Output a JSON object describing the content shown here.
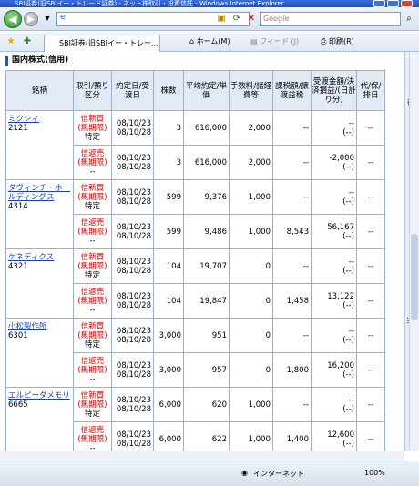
{
  "window": {
    "title": "SBI証券(旧SBIイー・トレード証券) - ネット株取引・投資信託 - Windows Internet Explorer"
  },
  "address": {
    "url": "e",
    "search_placeholder": "Google"
  },
  "toolbar": {
    "tab_label": "SBI証券(旧SBIイー・トレー...",
    "home": "ホーム(M)",
    "feed": "フィード (J)",
    "print": "印刷(R)"
  },
  "section": {
    "title": "国内株式(信用)"
  },
  "table": {
    "headers": [
      "銘柄",
      "取引/預り区分",
      "約定日/受渡日",
      "株数",
      "平均約定/単価",
      "手数料/諸経費等",
      "課税額/譲渡益税",
      "受渡金額/決済損益/(日計り分)",
      "代/保/排日"
    ],
    "rows": [
      {
        "name": "ミクシィ",
        "code": "2121",
        "type1": "信新買",
        "type2": "(無期限)",
        "type3": "特定",
        "d1": "08/10/23",
        "d2": "08/10/28",
        "qty": "3",
        "price": "616,000",
        "fee": "2,000",
        "tax": "--",
        "amt1": "--",
        "amt2": "(--)",
        "misc": "--"
      },
      {
        "name": "",
        "code": "",
        "type1": "信返売",
        "type2": "(無期限)",
        "type3": "--",
        "d1": "08/10/23",
        "d2": "08/10/28",
        "qty": "3",
        "price": "616,000",
        "fee": "2,000",
        "tax": "--",
        "amt1": "-2,000",
        "amt2": "(--)",
        "misc": "--"
      },
      {
        "name": "ダヴィンチ・ホールディングス",
        "code": "4314",
        "type1": "信新買",
        "type2": "(無期限)",
        "type3": "特定",
        "d1": "08/10/23",
        "d2": "08/10/28",
        "qty": "599",
        "price": "9,376",
        "fee": "1,000",
        "tax": "--",
        "amt1": "--",
        "amt2": "(--)",
        "misc": "--"
      },
      {
        "name": "",
        "code": "",
        "type1": "信返売",
        "type2": "(無期限)",
        "type3": "--",
        "d1": "08/10/23",
        "d2": "08/10/28",
        "qty": "599",
        "price": "9,486",
        "fee": "1,000",
        "tax": "8,543",
        "amt1": "56,167",
        "amt2": "(--)",
        "misc": "--"
      },
      {
        "name": "ケネディクス",
        "code": "4321",
        "type1": "信新買",
        "type2": "(無期限)",
        "type3": "特定",
        "d1": "08/10/23",
        "d2": "08/10/28",
        "qty": "104",
        "price": "19,707",
        "fee": "0",
        "tax": "--",
        "amt1": "--",
        "amt2": "(--)",
        "misc": "--"
      },
      {
        "name": "",
        "code": "",
        "type1": "信返売",
        "type2": "(無期限)",
        "type3": "--",
        "d1": "08/10/23",
        "d2": "08/10/28",
        "qty": "104",
        "price": "19,847",
        "fee": "0",
        "tax": "1,458",
        "amt1": "13,122",
        "amt2": "(--)",
        "misc": "--"
      },
      {
        "name": "小松製作所",
        "code": "6301",
        "type1": "信新買",
        "type2": "(無期限)",
        "type3": "特定",
        "d1": "08/10/23",
        "d2": "08/10/28",
        "qty": "3,000",
        "price": "951",
        "fee": "0",
        "tax": "--",
        "amt1": "--",
        "amt2": "(--)",
        "misc": "--"
      },
      {
        "name": "",
        "code": "",
        "type1": "信返売",
        "type2": "(無期限)",
        "type3": "--",
        "d1": "08/10/23",
        "d2": "08/10/28",
        "qty": "3,000",
        "price": "957",
        "fee": "0",
        "tax": "1,800",
        "amt1": "16,200",
        "amt2": "(--)",
        "misc": "--"
      },
      {
        "name": "エルピーダメモリ",
        "code": "6665",
        "type1": "信新買",
        "type2": "(無期限)",
        "type3": "特定",
        "d1": "08/10/23",
        "d2": "08/10/28",
        "qty": "6,000",
        "price": "620",
        "fee": "1,000",
        "tax": "--",
        "amt1": "--",
        "amt2": "(--)",
        "misc": "--"
      },
      {
        "name": "",
        "code": "",
        "type1": "信返売",
        "type2": "(無期限)",
        "type3": "--",
        "d1": "08/10/23",
        "d2": "08/10/28",
        "qty": "6,000",
        "price": "622",
        "fee": "1,000",
        "tax": "1,400",
        "amt1": "12,600",
        "amt2": "(--)",
        "misc": "--"
      }
    ]
  },
  "side": {
    "t1": "往",
    "t2": "当日"
  },
  "status": {
    "zone": "インターネット",
    "zoom": "100%"
  }
}
